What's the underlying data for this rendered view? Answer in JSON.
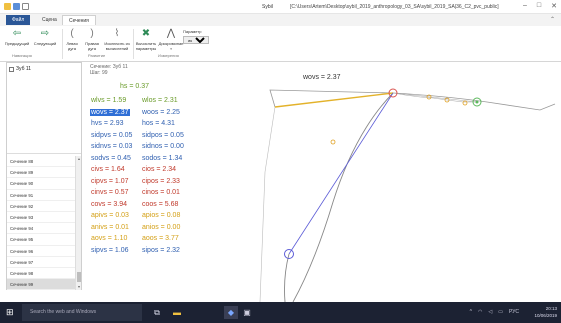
{
  "window": {
    "app_title": "Sybil",
    "path": "[C:\\Users\\Artem\\Desktop\\sybil_2019_anthropology_03_SA\\sybil_2019_SA|36_C2_pvc_public]",
    "controls": [
      "–",
      "□",
      "✕"
    ]
  },
  "tabs": {
    "file": "Файл",
    "tab1": "Сцена",
    "tab2": "Сечения"
  },
  "ribbon": {
    "buttons": [
      {
        "label": "Предыдущий",
        "icon": "⇦"
      },
      {
        "label": "Следующий",
        "icon": "⇨"
      },
      {
        "label": "Левая дуга",
        "icon": "("
      },
      {
        "label": "Правая дуга",
        "icon": ")"
      },
      {
        "label": "Исключить из вычислений",
        "icon": "⌇"
      },
      {
        "label": "Вычислить параметры",
        "icon": "✖"
      },
      {
        "label": "Дискриминан т",
        "icon": "⋀"
      }
    ],
    "groups": [
      "Навигация",
      "Развитие",
      "Измерения"
    ],
    "param_label": "Параметр",
    "param_value": "wo"
  },
  "leftpanel": {
    "top_item": "Зуб 11",
    "sections": [
      "Сечение 88",
      "Сечение 89",
      "Сечение 90",
      "Сечение 91",
      "Сечение 92",
      "Сечение 93",
      "Сечение 94",
      "Сечение 95",
      "Сечение 96",
      "Сечение 97",
      "Сечение 98",
      "Сечение 99"
    ],
    "selected_index": 11
  },
  "measurements": {
    "header_line1": "Сечение: Зуб 11",
    "header_line2": "Шаг: 99",
    "hs": "hs = 0.37",
    "rows": [
      {
        "a": "wlvs = 1.59",
        "b": "wlos = 2.31",
        "color": "#6a9b2a"
      },
      {
        "a": "wovs = 2.37",
        "b": "woos = 2.25",
        "color": "#2f5fb0",
        "highlight": true
      },
      {
        "a": "hvs = 2.93",
        "b": "hos = 4.31",
        "color": "#2f5fb0"
      },
      {
        "a": "sidpvs = 0.05",
        "b": "sidpos = 0.05",
        "color": "#2f5fb0"
      },
      {
        "a": "sidnvs = 0.03",
        "b": "sidnos = 0.00",
        "color": "#2f5fb0"
      },
      {
        "a": "sodvs = 0.45",
        "b": "sodos = 1.34",
        "color": "#2f5fb0"
      },
      {
        "a": "civs = 1.64",
        "b": "cios = 2.34",
        "color": "#c0392b"
      },
      {
        "a": "cipvs = 1.07",
        "b": "cipos = 2.33",
        "color": "#c0392b"
      },
      {
        "a": "cinvs = 0.57",
        "b": "cinos = 0.01",
        "color": "#c0392b"
      },
      {
        "a": "covs = 3.94",
        "b": "coos = 5.68",
        "color": "#c0392b"
      },
      {
        "a": "apivs = 0.03",
        "b": "apios = 0.08",
        "color": "#d4a017"
      },
      {
        "a": "anivs = 0.01",
        "b": "anios = 0.00",
        "color": "#d4a017"
      },
      {
        "a": "aovs = 1.10",
        "b": "aoos = 3.77",
        "color": "#d4a017"
      },
      {
        "a": "sipvs = 1.06",
        "b": "sipos = 2.32",
        "color": "#2f5fb0"
      }
    ]
  },
  "canvas": {
    "label": "wovs = 2.37"
  },
  "taskbar": {
    "search_placeholder": "Search the web and Windows",
    "lang": "РУС",
    "time": "20:13",
    "date": "10/06/2019"
  },
  "colors": {
    "accent": "#2b5797",
    "taskbar": "#1c2233",
    "highlight": "#2f6fd6"
  }
}
